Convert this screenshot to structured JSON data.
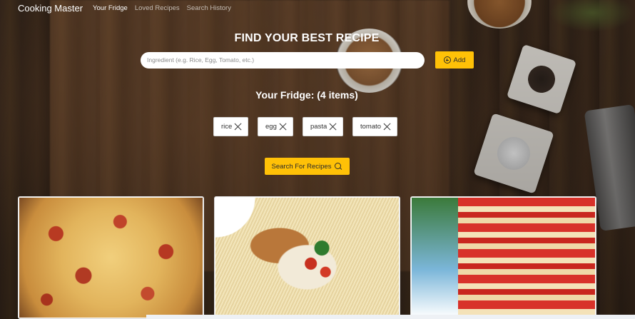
{
  "navbar": {
    "brand": "Cooking Master",
    "links": [
      {
        "label": "Your Fridge",
        "active": true
      },
      {
        "label": "Loved Recipes",
        "active": false
      },
      {
        "label": "Search History",
        "active": false
      }
    ]
  },
  "hero": {
    "title": "FIND YOUR BEST RECIPE",
    "search": {
      "placeholder": "Ingredient (e.g. Rice, Egg, Tomato, etc.)",
      "value": ""
    },
    "add_label": "Add"
  },
  "fridge": {
    "heading": "Your Fridge: (4 items)",
    "items": [
      "rice",
      "egg",
      "pasta",
      "tomato"
    ]
  },
  "search_button": {
    "label": "Search For Recipes"
  },
  "recipes": [
    {
      "image": "pizza"
    },
    {
      "image": "chicken pasta"
    },
    {
      "image": "lasagna"
    }
  ],
  "colors": {
    "accent": "#ffc107",
    "text_light": "#ffffff"
  },
  "icons": [
    "plus-circle-icon",
    "close-icon",
    "search-icon"
  ]
}
